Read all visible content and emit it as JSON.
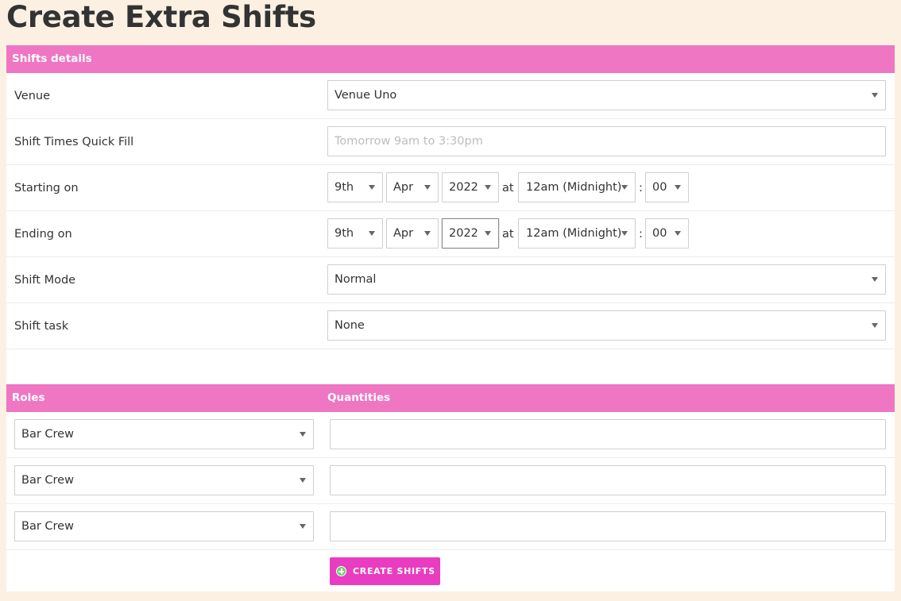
{
  "page": {
    "title": "Create Extra Shifts"
  },
  "shift_details": {
    "header": "Shifts details",
    "venue": {
      "label": "Venue",
      "value": "Venue Uno"
    },
    "quick_fill": {
      "label": "Shift Times Quick Fill",
      "placeholder": "Tomorrow 9am to 3:30pm",
      "value": ""
    },
    "starting_on": {
      "label": "Starting on",
      "day": "9th",
      "month": "Apr",
      "year": "2022",
      "at": "at",
      "hour": "12am (Midnight)",
      "colon": ":",
      "minute": "00"
    },
    "ending_on": {
      "label": "Ending on",
      "day": "9th",
      "month": "Apr",
      "year": "2022",
      "at": "at",
      "hour": "12am (Midnight)",
      "colon": ":",
      "minute": "00"
    },
    "shift_mode": {
      "label": "Shift Mode",
      "value": "Normal"
    },
    "shift_task": {
      "label": "Shift task",
      "value": "None"
    }
  },
  "roles": {
    "header_roles": "Roles",
    "header_quantities": "Quantities",
    "rows": [
      {
        "role": "Bar Crew",
        "quantity": ""
      },
      {
        "role": "Bar Crew",
        "quantity": ""
      },
      {
        "role": "Bar Crew",
        "quantity": ""
      }
    ]
  },
  "actions": {
    "create_label": "CREATE SHIFTS",
    "create_icon": "plus-circle-icon"
  },
  "colors": {
    "header_bg": "#ee76c3",
    "button_bg": "#e83dc0",
    "page_bg": "#fbf0e2",
    "icon_green": "#6fd16f"
  }
}
